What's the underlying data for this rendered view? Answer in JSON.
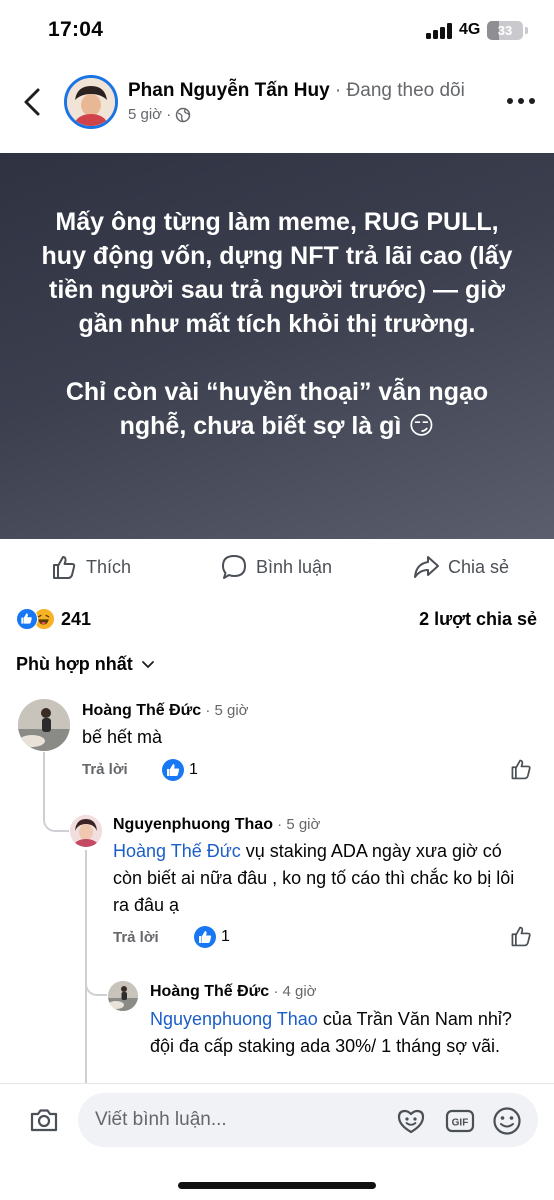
{
  "status_bar": {
    "time": "17:04",
    "network": "4G",
    "battery": "33",
    "battery_level": 0.33
  },
  "post": {
    "author": "Phan Nguyễn Tấn Huy",
    "follow_status": " · Đang theo dõi",
    "time": "5 giờ ·",
    "privacy_icon": "globe-icon",
    "paragraph1": "Mấy ông từng làm meme, RUG PULL, huy động vốn, dựng NFT trả lãi cao (lấy tiền người sau trả người trước) — giờ gần như mất tích khỏi thị trường.",
    "paragraph2": "Chỉ còn vài “huyền thoại” vẫn ngạo nghễ, chưa biết sợ là gì 😏",
    "bg_colors": [
      "#2e3241",
      "#5a5e6d"
    ]
  },
  "actions": {
    "like": "Thích",
    "comment": "Bình luận",
    "share": "Chia sẻ"
  },
  "stats": {
    "reactions_count": "241",
    "shares": "2 lượt chia sẻ"
  },
  "sort": {
    "label": "Phù hợp nhất"
  },
  "comments": [
    {
      "name": "Hoàng Thế Đức",
      "time": " · 5 giờ",
      "text": "bế hết mà",
      "reply": "Trả lời",
      "likes": "1"
    },
    {
      "name": "Nguyenphuong Thao",
      "time": " · 5 giờ",
      "mention": "Hoàng Thế Đức",
      "text": " vụ staking ADA ngày xưa giờ có còn biết ai nữa đâu , ko ng tố cáo thì chắc ko bị lôi ra đâu ạ",
      "reply": "Trả lời",
      "likes": "1"
    },
    {
      "name": "Hoàng Thế Đức",
      "time": " · 4 giờ",
      "mention": "Nguyenphuong Thao",
      "text": "  của Trần Văn Nam nhỉ? đội đa cấp staking ada 30%/ 1 tháng sợ vãi."
    }
  ],
  "composer": {
    "placeholder": "Viết bình luận..."
  },
  "colors": {
    "accent": "#1877f2",
    "mention": "#1b5ec9",
    "muted": "#65676b"
  }
}
